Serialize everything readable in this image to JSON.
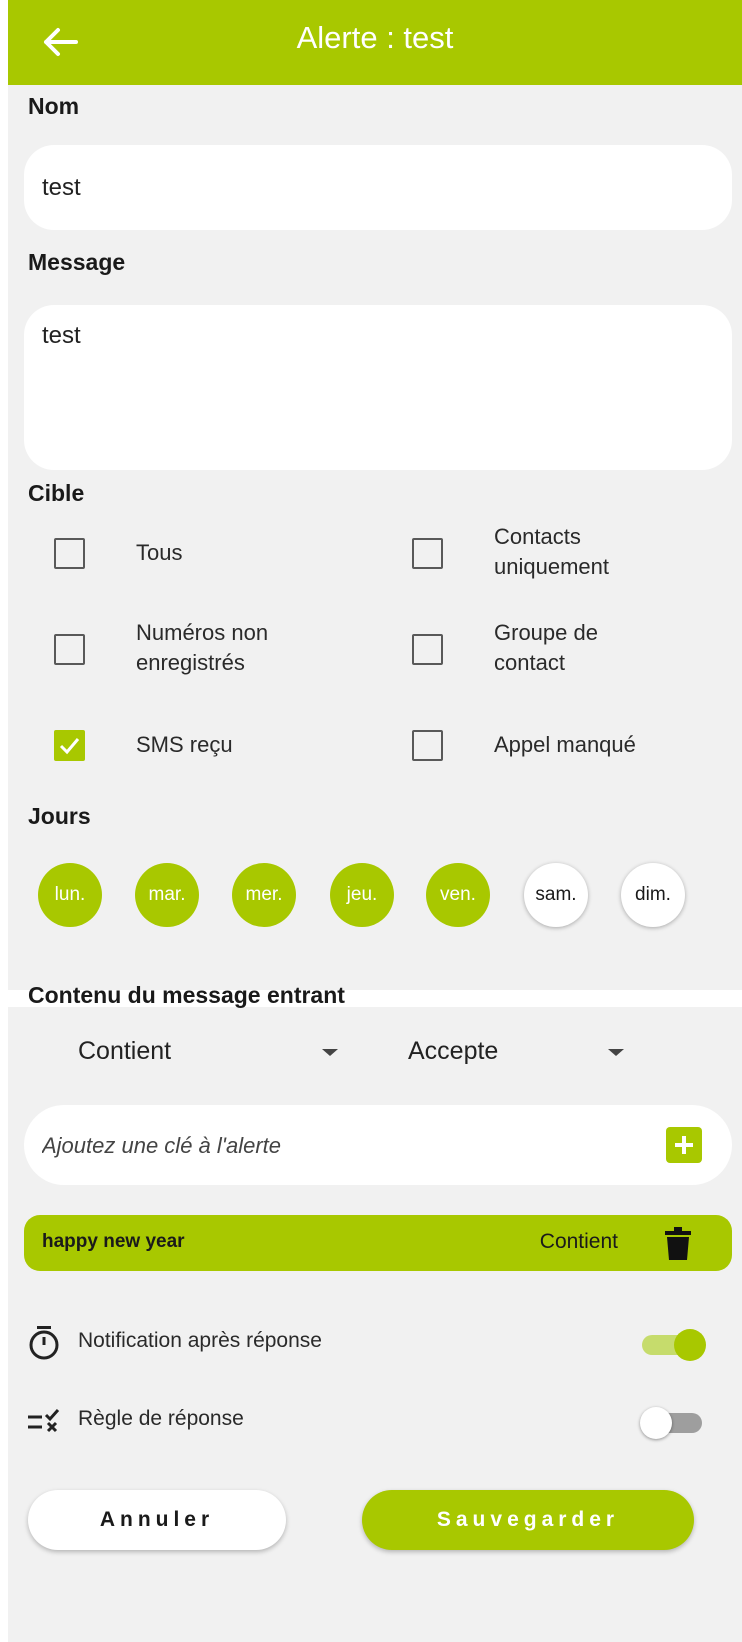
{
  "header": {
    "title": "Alerte : test"
  },
  "form": {
    "name_label": "Nom",
    "name_value": "test",
    "message_label": "Message",
    "message_value": "test"
  },
  "target": {
    "label": "Cible",
    "options": [
      {
        "label": "Tous",
        "checked": false
      },
      {
        "label": "Contacts uniquement",
        "checked": false
      },
      {
        "label": "Numéros non enregistrés",
        "checked": false
      },
      {
        "label": "Groupe de contact",
        "checked": false
      },
      {
        "label": "SMS reçu",
        "checked": true
      },
      {
        "label": "Appel manqué",
        "checked": false
      }
    ]
  },
  "days": {
    "label": "Jours",
    "items": [
      {
        "label": "lun.",
        "active": true
      },
      {
        "label": "mar.",
        "active": true
      },
      {
        "label": "mer.",
        "active": true
      },
      {
        "label": "jeu.",
        "active": true
      },
      {
        "label": "ven.",
        "active": true
      },
      {
        "label": "sam.",
        "active": false
      },
      {
        "label": "dim.",
        "active": false
      }
    ]
  },
  "incoming": {
    "label": "Contenu du message entrant",
    "match_mode": "Contient",
    "action": "Accepte",
    "key_placeholder": "Ajoutez une clé à l'alerte",
    "keywords": [
      {
        "text": "happy new year",
        "mode": "Contient"
      }
    ]
  },
  "options": {
    "notification_after_reply": {
      "label": "Notification après réponse",
      "enabled": true
    },
    "reply_rule": {
      "label": "Règle de réponse",
      "enabled": false
    }
  },
  "buttons": {
    "cancel": "Annuler",
    "save": "Sauvegarder"
  },
  "colors": {
    "accent": "#a8c800",
    "panel": "#f1f1f1"
  }
}
